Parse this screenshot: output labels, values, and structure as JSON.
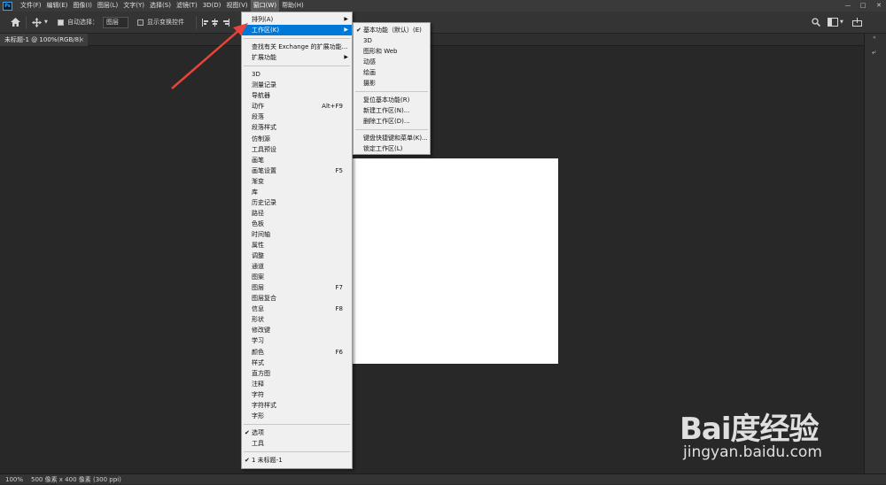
{
  "app": {
    "logo_text": "Ps"
  },
  "menubar": {
    "items": [
      "文件(F)",
      "编辑(E)",
      "图像(I)",
      "图层(L)",
      "文字(Y)",
      "选择(S)",
      "滤镜(T)",
      "3D(D)",
      "视图(V)",
      "窗口(W)",
      "帮助(H)"
    ],
    "active_index": 9
  },
  "window_controls": {
    "minimize": "—",
    "maximize": "□",
    "close": "✕"
  },
  "options": {
    "auto_select_label": "自动选择：",
    "auto_select_checked": true,
    "layer_select_value": "图层",
    "show_transform_label": "显示变换控件",
    "show_transform_checked": false
  },
  "document": {
    "tab_title": "未标题-1 @ 100%(RGB/8)",
    "zoom": "100%",
    "doc_info": "500 像素 x 400 像素 (300 ppi)"
  },
  "window_menu": {
    "items": [
      {
        "label": "排列(A)",
        "submenu": true
      },
      {
        "label": "工作区(K)",
        "submenu": true,
        "highlighted": true
      },
      {
        "sep": true
      },
      {
        "label": "查找有关 Exchange 的扩展功能..."
      },
      {
        "label": "扩展功能",
        "submenu": true
      },
      {
        "sep": true
      },
      {
        "label": "3D"
      },
      {
        "label": "测量记录"
      },
      {
        "label": "导航器"
      },
      {
        "label": "动作",
        "shortcut": "Alt+F9"
      },
      {
        "label": "段落"
      },
      {
        "label": "段落样式"
      },
      {
        "label": "仿制源"
      },
      {
        "label": "工具预设"
      },
      {
        "label": "画笔"
      },
      {
        "label": "画笔设置",
        "shortcut": "F5"
      },
      {
        "label": "渐变"
      },
      {
        "label": "库"
      },
      {
        "label": "历史记录"
      },
      {
        "label": "路径"
      },
      {
        "label": "色板"
      },
      {
        "label": "时间轴"
      },
      {
        "label": "属性"
      },
      {
        "label": "调整"
      },
      {
        "label": "通道"
      },
      {
        "label": "图案"
      },
      {
        "label": "图层",
        "shortcut": "F7"
      },
      {
        "label": "图层复合"
      },
      {
        "label": "信息",
        "shortcut": "F8"
      },
      {
        "label": "形状"
      },
      {
        "label": "修改键"
      },
      {
        "label": "学习"
      },
      {
        "label": "颜色",
        "shortcut": "F6"
      },
      {
        "label": "样式"
      },
      {
        "label": "直方图"
      },
      {
        "label": "注释"
      },
      {
        "label": "字符"
      },
      {
        "label": "字符样式"
      },
      {
        "label": "字形"
      },
      {
        "sep": true
      },
      {
        "label": "选项",
        "checked": true
      },
      {
        "label": "工具"
      },
      {
        "sep": true
      },
      {
        "label": "1 未标题-1",
        "checked": true
      }
    ]
  },
  "workspace_submenu": {
    "items": [
      {
        "label": "基本功能（默认）(E)",
        "checked": true
      },
      {
        "label": "3D"
      },
      {
        "label": "图形和 Web"
      },
      {
        "label": "动感"
      },
      {
        "label": "绘画"
      },
      {
        "label": "摄影"
      },
      {
        "sep": true
      },
      {
        "label": "复位基本功能(R)"
      },
      {
        "label": "新建工作区(N)..."
      },
      {
        "label": "删除工作区(D)..."
      },
      {
        "sep": true
      },
      {
        "label": "键盘快捷键和菜单(K)..."
      },
      {
        "label": "锁定工作区(L)"
      }
    ]
  },
  "watermark": {
    "logo": "Bai度经验",
    "url": "jingyan.baidu.com"
  },
  "colors": {
    "menu_highlight": "#0078d7",
    "annotation_arrow": "#e8433a"
  }
}
